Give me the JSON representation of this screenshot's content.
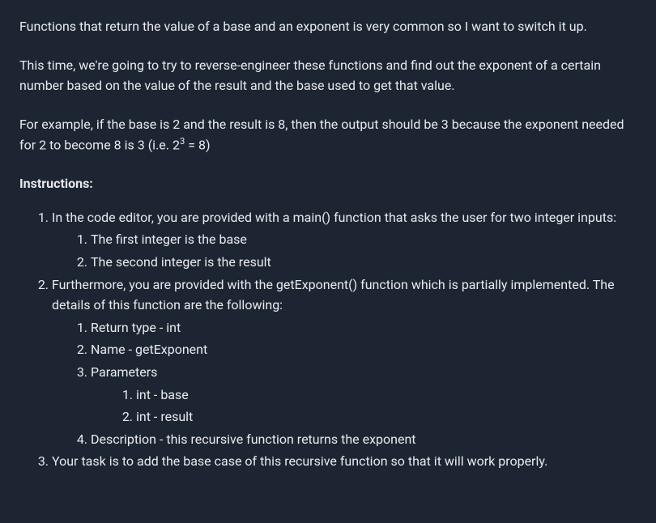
{
  "intro": {
    "p1": "Functions that return the value of a base and an exponent is very common so I want to switch it up.",
    "p2": "This time, we're going to try to reverse-engineer these functions and find out the exponent of a certain number based on the value of the result and the base used to get that value.",
    "p3_part1": "For example, if the base is 2 and the result is 8, then the output should be 3 because the exponent needed for 2 to become 8 is 3 (i.e. 2",
    "p3_sup": "3",
    "p3_part2": " = 8)"
  },
  "instructions_heading": "Instructions:",
  "list": {
    "item1": "In the code editor, you are provided with a main() function that asks the user for two integer inputs:",
    "item1_sub": {
      "a": "The first integer is the base",
      "b": "The second integer is the result"
    },
    "item2": "Furthermore, you are provided with the getExponent() function which is partially implemented. The details of this function are the following:",
    "item2_sub": {
      "a": "Return type - int",
      "b": "Name - getExponent",
      "c": "Parameters",
      "c_sub": {
        "x": "int - base",
        "y": "int - result"
      },
      "d": "Description - this recursive function returns the exponent"
    },
    "item3": "Your task is to add the base case of this recursive function so that it will work properly."
  }
}
